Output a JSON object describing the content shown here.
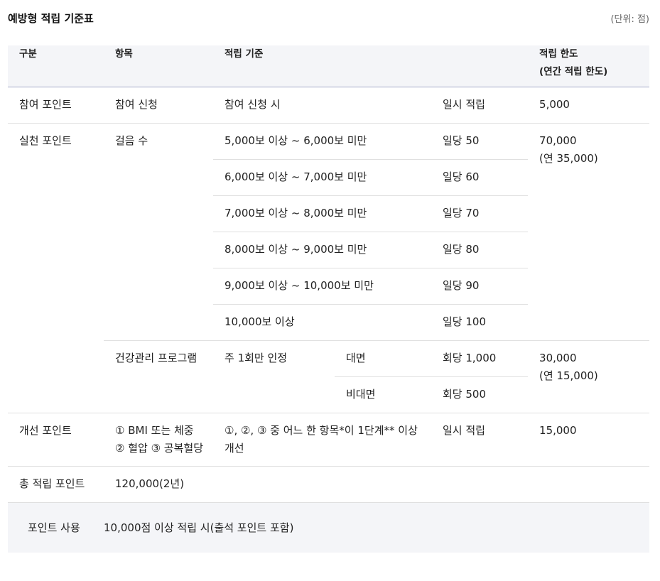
{
  "title": "예방형 적립 기준표",
  "unit": "(단위: 점)",
  "headers": {
    "category": "구분",
    "item": "항목",
    "criteria": "적립 기준",
    "limit_line1": "적립 한도",
    "limit_line2": "(연간 적립 한도)"
  },
  "participation": {
    "category": "참여 포인트",
    "item": "참여 신청",
    "criteria": "참여 신청 시",
    "points": "일시 적립",
    "limit": "5,000"
  },
  "practice": {
    "category": "실천 포인트",
    "steps": {
      "item": "걸음 수",
      "limit_line1": "70,000",
      "limit_line2": "(연 35,000)",
      "rows": [
        {
          "criteria": "5,000보 이상 ~ 6,000보 미만",
          "points": "일당 50"
        },
        {
          "criteria": "6,000보 이상 ~ 7,000보 미만",
          "points": "일당 60"
        },
        {
          "criteria": "7,000보 이상 ~ 8,000보 미만",
          "points": "일당 70"
        },
        {
          "criteria": "8,000보 이상 ~ 9,000보 미만",
          "points": "일당 80"
        },
        {
          "criteria": "9,000보 이상 ~ 10,000보 미만",
          "points": "일당 90"
        },
        {
          "criteria": "10,000보 이상",
          "points": "일당 100"
        }
      ]
    },
    "program": {
      "item": "건강관리 프로그램",
      "criteria": "주 1회만 인정",
      "face": "대면",
      "face_points": "회당 1,000",
      "nonface": "비대면",
      "nonface_points": "회당 500",
      "limit_line1": "30,000",
      "limit_line2": "(연 15,000)"
    }
  },
  "improvement": {
    "category": "개선 포인트",
    "item": "① BMI 또는 체중 ② 혈압 ③ 공복혈당",
    "criteria": "①, ②, ③ 중 어느 한 항목*이 1단계** 이상 개선",
    "points": "일시 적립",
    "limit": "15,000"
  },
  "total": {
    "category": "총 적립 포인트",
    "value": "120,000(2년)"
  },
  "usage": {
    "label": "포인트 사용",
    "value": "10,000점 이상 적립 시(출석 포인트 포함)"
  }
}
